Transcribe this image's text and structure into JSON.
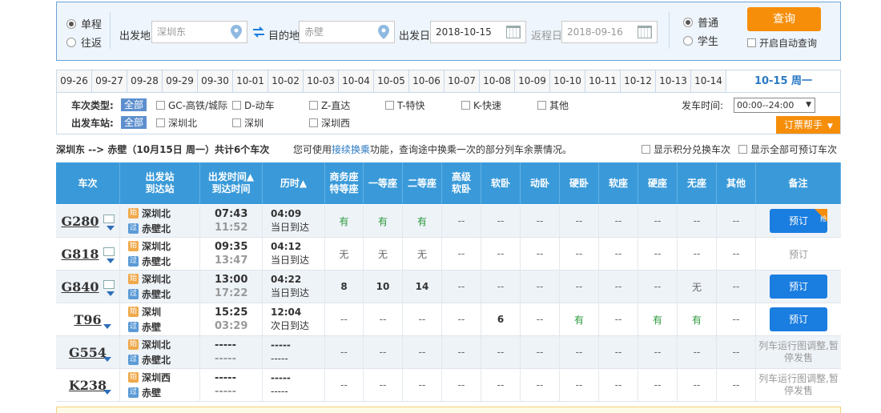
{
  "search": {
    "trip_single": "单程",
    "trip_round": "往返",
    "from_label": "出发地",
    "from_value": "深圳东",
    "to_label": "目的地",
    "to_value": "赤壁",
    "depart_label": "出发日",
    "depart_value": "2018-10-15",
    "return_label": "返程日",
    "return_value": "2018-09-16",
    "type_normal": "普通",
    "type_student": "学生",
    "query_button": "查询",
    "auto_query": "开启自动查询"
  },
  "dates": [
    "09-26",
    "09-27",
    "09-28",
    "09-29",
    "09-30",
    "10-01",
    "10-02",
    "10-03",
    "10-04",
    "10-05",
    "10-06",
    "10-07",
    "10-08",
    "10-09",
    "10-10",
    "10-11",
    "10-12",
    "10-13",
    "10-14"
  ],
  "selected_date": "10-15 周一",
  "filter": {
    "type_label": "车次类型:",
    "station_label": "出发车站:",
    "all": "全部",
    "types": [
      "GC-高铁/城际",
      "D-动车",
      "Z-直达",
      "T-特快",
      "K-快速",
      "其他"
    ],
    "stations": [
      "深圳北",
      "深圳",
      "深圳西"
    ],
    "time_label": "发车时间:",
    "time_value": "00:00--24:00",
    "helper": "订票帮手"
  },
  "summary": {
    "route": "深圳东 --> 赤壁（10月15日 周一）共计6个车次",
    "hint_pre": "您可使用",
    "hint_link": "接续换乘",
    "hint_post": "功能，查询途中换乘一次的部分列车余票情况。",
    "opt1": "显示积分兑换车次",
    "opt2": "显示全部可预订车次"
  },
  "table": {
    "headers": [
      "车次",
      "出发站\n到达站",
      "出发时间▲\n到达时间",
      "历时▲",
      "商务座\n特等座",
      "一等座",
      "二等座",
      "高级\n软卧",
      "软卧",
      "动卧",
      "硬卧",
      "软座",
      "硬座",
      "无座",
      "其他",
      "备注"
    ],
    "tag_start": "始",
    "tag_pass": "过",
    "rows": [
      {
        "train": "G280",
        "from": "深圳北",
        "to": "赤壁北",
        "dep": "07:43",
        "arr": "11:52",
        "dur": "04:09",
        "arrival": "当日到达",
        "seats": [
          "有",
          "有",
          "有",
          "--",
          "--",
          "--",
          "--",
          "--",
          "--",
          "--",
          "--"
        ],
        "note": "预订",
        "bookable": true,
        "badge": "抢"
      },
      {
        "train": "G818",
        "from": "深圳北",
        "to": "赤壁北",
        "dep": "09:35",
        "arr": "13:47",
        "dur": "04:12",
        "arrival": "当日到达",
        "seats": [
          "无",
          "无",
          "无",
          "--",
          "--",
          "--",
          "--",
          "--",
          "--",
          "--",
          "--"
        ],
        "note": "预订",
        "bookable": false,
        "badge": ""
      },
      {
        "train": "G840",
        "from": "深圳北",
        "to": "赤壁北",
        "dep": "13:00",
        "arr": "17:22",
        "dur": "04:22",
        "arrival": "当日到达",
        "seats": [
          "8",
          "10",
          "14",
          "--",
          "--",
          "--",
          "--",
          "--",
          "--",
          "无",
          "--"
        ],
        "note": "预订",
        "bookable": true,
        "badge": ""
      },
      {
        "train": "T96",
        "from": "深圳",
        "to": "赤壁",
        "dep": "15:25",
        "arr": "03:29",
        "dur": "12:04",
        "arrival": "次日到达",
        "seats": [
          "--",
          "--",
          "--",
          "--",
          "6",
          "--",
          "有",
          "--",
          "有",
          "有",
          "--"
        ],
        "note": "预订",
        "bookable": true,
        "badge": ""
      },
      {
        "train": "G554",
        "from": "深圳北",
        "to": "赤壁北",
        "dep": "-----",
        "arr": "-----",
        "dur": "-----",
        "arrival": "-----",
        "seats": [
          "--",
          "--",
          "--",
          "--",
          "--",
          "--",
          "--",
          "--",
          "--",
          "--",
          "--"
        ],
        "note": "列车运行图调整,暂停发售",
        "bookable": false,
        "badge": ""
      },
      {
        "train": "K238",
        "from": "深圳西",
        "to": "赤壁",
        "dep": "-----",
        "arr": "-----",
        "dur": "-----",
        "arrival": "-----",
        "seats": [
          "--",
          "--",
          "--",
          "--",
          "--",
          "--",
          "--",
          "--",
          "--",
          "--",
          "--"
        ],
        "note": "列车运行图调整,暂停发售",
        "bookable": false,
        "badge": ""
      }
    ]
  },
  "colors": {
    "accent": "#3a9ad9",
    "orange": "#f68e0a",
    "book": "#1a7de0",
    "yes": "#2a9a3a"
  }
}
